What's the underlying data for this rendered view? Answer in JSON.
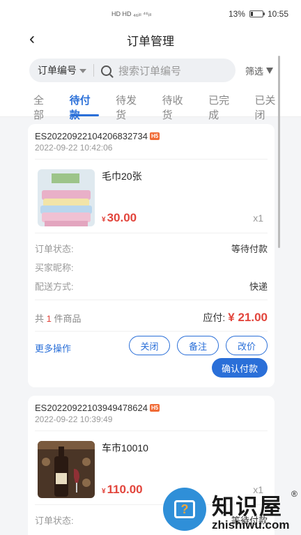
{
  "status_bar": {
    "signal_text": "HD HD ₄₆ᵢₗₗ ⁴⁶ᵢₗₗ",
    "battery": "13%",
    "time": "10:55"
  },
  "nav": {
    "title": "订单管理"
  },
  "search": {
    "select_label": "订单编号",
    "placeholder": "搜索订单编号",
    "filter_label": "筛选"
  },
  "tabs": [
    "全部",
    "待付款",
    "待发货",
    "待收货",
    "已完成",
    "已关闭"
  ],
  "active_tab": 1,
  "orders": [
    {
      "order_no": "ES20220922104206832734",
      "badge": "H5",
      "time": "2022-09-22 10:42:06",
      "goods_name": "毛巾20张",
      "price_symbol": "¥",
      "price": "30.00",
      "qty": "x1",
      "status_label": "订单状态:",
      "status_value": "等待付款",
      "buyer_label": "买家昵称:",
      "delivery_label": "配送方式:",
      "delivery_value": "快递",
      "total_prefix": "共",
      "total_count": "1",
      "total_suffix": "件商品",
      "pay_label": "应付:",
      "pay_value": "¥ 21.00",
      "more_label": "更多操作",
      "btn_close": "关闭",
      "btn_note": "备注",
      "btn_price": "改价",
      "btn_confirm": "确认付款"
    },
    {
      "order_no": "ES20220922103949478624",
      "badge": "H5",
      "time": "2022-09-22 10:39:49",
      "goods_name": "车市10010",
      "price_symbol": "¥",
      "price": "110.00",
      "qty": "x1",
      "status_label": "订单状态:",
      "status_value": "等待付款"
    }
  ],
  "watermark": {
    "brand": "知识屋",
    "reg": "®",
    "url": "zhishiwu.com",
    "icon_glyph": "?"
  }
}
